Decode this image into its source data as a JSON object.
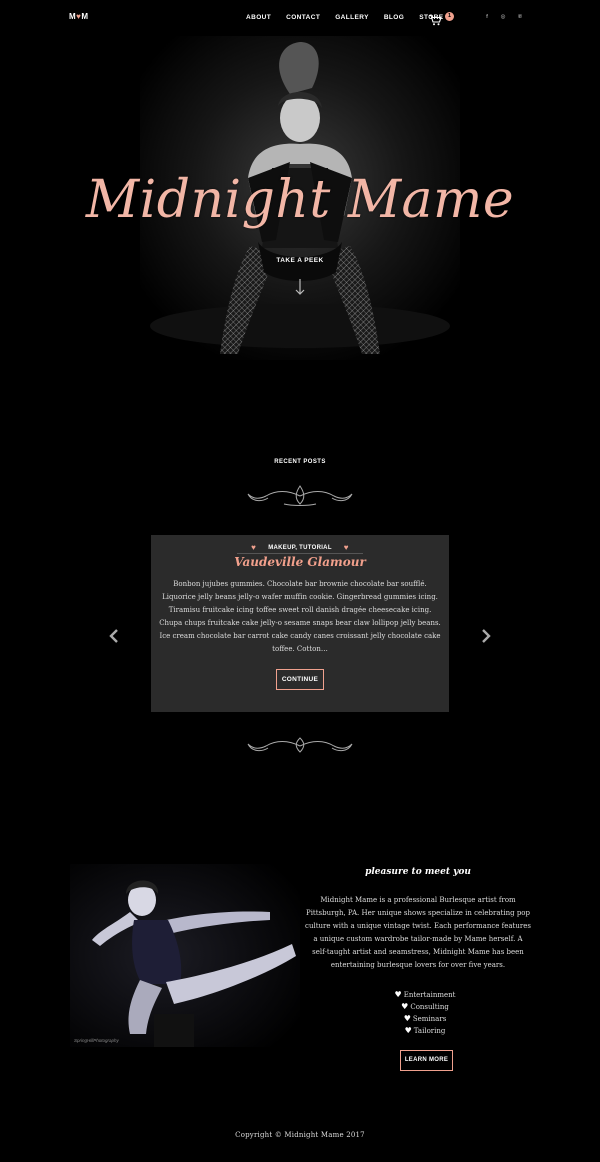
{
  "nav": {
    "logo_left": "M",
    "logo_heart": "♥",
    "logo_right": "M",
    "items": [
      {
        "label": "ABOUT"
      },
      {
        "label": "CONTACT"
      },
      {
        "label": "GALLERY"
      },
      {
        "label": "BLOG"
      },
      {
        "label": "STORE"
      }
    ],
    "cart_count": "1",
    "social": [
      "f",
      "◎",
      "℗"
    ]
  },
  "hero": {
    "title": "Midnight Mame",
    "cta": "TAKE A PEEK"
  },
  "recent": {
    "title": "RECENT POSTS",
    "post": {
      "tags": "MAKEUP, TUTORIAL",
      "title": "Vaudeville Glamour",
      "excerpt": "Bonbon jujubes gummies. Chocolate bar brownie chocolate bar soufflé. Liquorice jelly beans jelly-o wafer muffin cookie. Gingerbread gummies icing. Tiramisu fruitcake icing toffee sweet roll danish dragée cheesecake icing. Chupa chups fruitcake cake jelly-o sesame snaps bear claw lollipop jelly beans. Ice cream chocolate bar carrot cake candy canes croissant jelly chocolate cake toffee. Cotton…",
      "button": "CONTINUE"
    }
  },
  "about": {
    "photo_credit": "SpringHillPhotography",
    "heading": "pleasure to meet you",
    "text": "Midnight Mame is a professional Burlesque artist from Pittsburgh, PA. Her unique shows specialize in celebrating pop culture with a unique vintage twist. Each performance features a unique custom wardrobe tailor-made by Mame herself. A self-taught artist and seamstress, Midnight Mame has been entertaining burlesque lovers for over five years.",
    "services": [
      "Entertainment",
      "Consulting",
      "Seminars",
      "Tailoring"
    ],
    "button": "LEARN MORE"
  },
  "footer": {
    "copyright": "Copyright © Midnight Mame 2017"
  },
  "colors": {
    "background": "#000000",
    "accent": "#f0a18e",
    "card": "#2b2b2b"
  }
}
